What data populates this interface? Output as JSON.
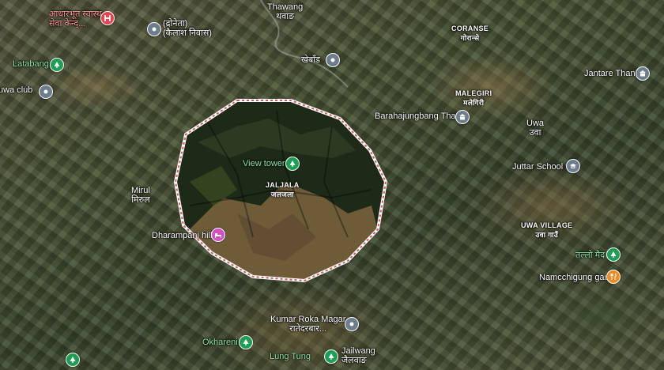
{
  "places": {
    "thawang": {
      "en": "Thawang",
      "ne": "थवाङ"
    },
    "dronepta": {
      "line1": "(द्रोनेता)",
      "line2": "(कैलाश निवास)"
    },
    "health_post": {
      "line1": "आधारभूत स्वास्थ्",
      "line2": "सेवा केन्द्..."
    },
    "latabang": "Latabang",
    "uwa_club": "uwa club",
    "khebad": "खेबाँड",
    "coranse": {
      "en": "CORANSE",
      "ne": "गोरान्से"
    },
    "jantare_than": "Jantare Than",
    "malegiri": {
      "en": "MALEGIRI",
      "ne": "मलेगिरी"
    },
    "barahajungbang": "Barahajungbang Than",
    "uwa": {
      "en": "Uwa",
      "ne": "उवा"
    },
    "view_tower": "View tower",
    "jaljala": {
      "en": "JALJALA",
      "ne": "जलजला"
    },
    "juttar_school": "Juttar School",
    "mirul": {
      "en": "Mirul",
      "ne": "मिरुल"
    },
    "dharampani": "Dharampani hill",
    "uwa_village": {
      "en": "UWA VILLAGE",
      "ne": "उवा गाउँ"
    },
    "tallo_maidan": "तल्लो मैद",
    "namcchigung": "Namcchigung gau",
    "kumar_roka": {
      "line1": "Kumar Roka Magar",
      "line2": "रातेदरबार..."
    },
    "okhareni": "Okhareni",
    "lung_tung": "Lung Tung",
    "jailwang": {
      "en": "Jailwang",
      "ne": "जैलवाङ"
    }
  },
  "colors": {
    "highlight_border": "#f3d2d2",
    "poi_gray": "#6e7d8c",
    "poi_green": "#1f9d55",
    "poi_red": "#e8434f",
    "poi_orange": "#f08a24",
    "poi_pink": "#d64ec4",
    "label_green": "#8ee6a8",
    "label_red": "#ff9b9b"
  },
  "icons": {
    "place": "place-marker-icon",
    "park": "tree-icon",
    "hospital": "hospital-icon",
    "school": "school-icon",
    "temple": "temple-icon",
    "hotel": "bed-icon",
    "food": "restaurant-icon"
  }
}
